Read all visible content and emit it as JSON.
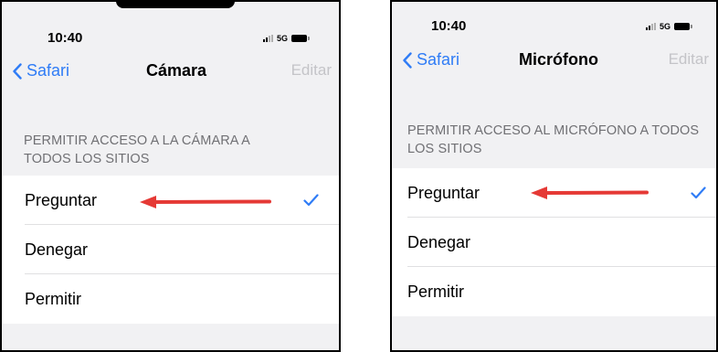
{
  "screens": [
    {
      "status_time": "10:40",
      "network": "5G",
      "back_label": "Safari",
      "title": "Cámara",
      "edit_label": "Editar",
      "section_header": "PERMITIR ACCESO A LA CÁMARA A TODOS LOS SITIOS",
      "options": [
        {
          "label": "Preguntar",
          "selected": true
        },
        {
          "label": "Denegar",
          "selected": false
        },
        {
          "label": "Permitir",
          "selected": false
        }
      ]
    },
    {
      "status_time": "10:40",
      "network": "5G",
      "back_label": "Safari",
      "title": "Micrófono",
      "edit_label": "Editar",
      "section_header": "PERMITIR ACCESO AL MICRÓFONO A TODOS LOS SITIOS",
      "options": [
        {
          "label": "Preguntar",
          "selected": true
        },
        {
          "label": "Denegar",
          "selected": false
        },
        {
          "label": "Permitir",
          "selected": false
        }
      ]
    }
  ],
  "colors": {
    "accent": "#2f7cf6",
    "annotation_arrow": "#e53935",
    "background": "#f1f1f3",
    "section_header": "#707074",
    "disabled": "#c4c4c8"
  },
  "icons": [
    "chevron-left-icon",
    "checkmark-icon",
    "signal-icon",
    "battery-icon",
    "arrow-annotation"
  ]
}
